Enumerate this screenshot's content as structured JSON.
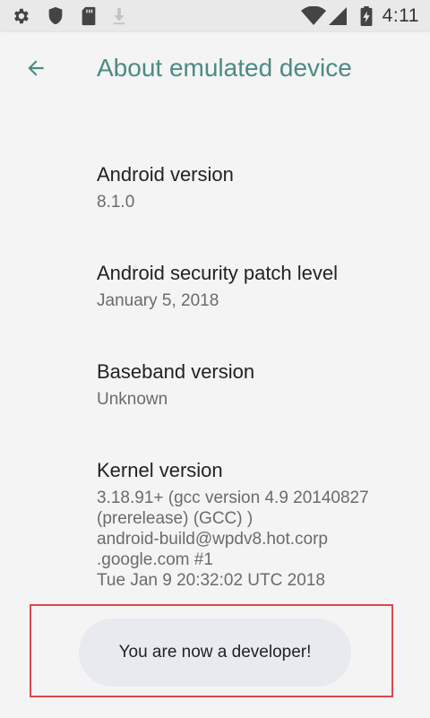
{
  "status_bar": {
    "time": "4:11",
    "left_icons": [
      "gear-icon",
      "shield-icon",
      "sd-card-icon",
      "download-icon"
    ],
    "right_icons": [
      "wifi-icon",
      "signal-icon",
      "battery-icon"
    ]
  },
  "toolbar": {
    "title": "About emulated device",
    "accent_color": "#4b8b84"
  },
  "items": [
    {
      "title": "Android version",
      "summary": [
        "8.1.0"
      ]
    },
    {
      "title": "Android security patch level",
      "summary": [
        "January 5, 2018"
      ]
    },
    {
      "title": "Baseband version",
      "summary": [
        "Unknown"
      ]
    },
    {
      "title": "Kernel version",
      "summary": [
        "3.18.91+ (gcc version 4.9 20140827",
        "(prerelease) (GCC) )",
        "android-build@wpdv8.hot.corp",
        ".google.com #1",
        "Tue Jan 9 20:32:02 UTC 2018"
      ]
    }
  ],
  "toast": {
    "message": "You are now a developer!",
    "highlight_color": "#d9484e"
  }
}
